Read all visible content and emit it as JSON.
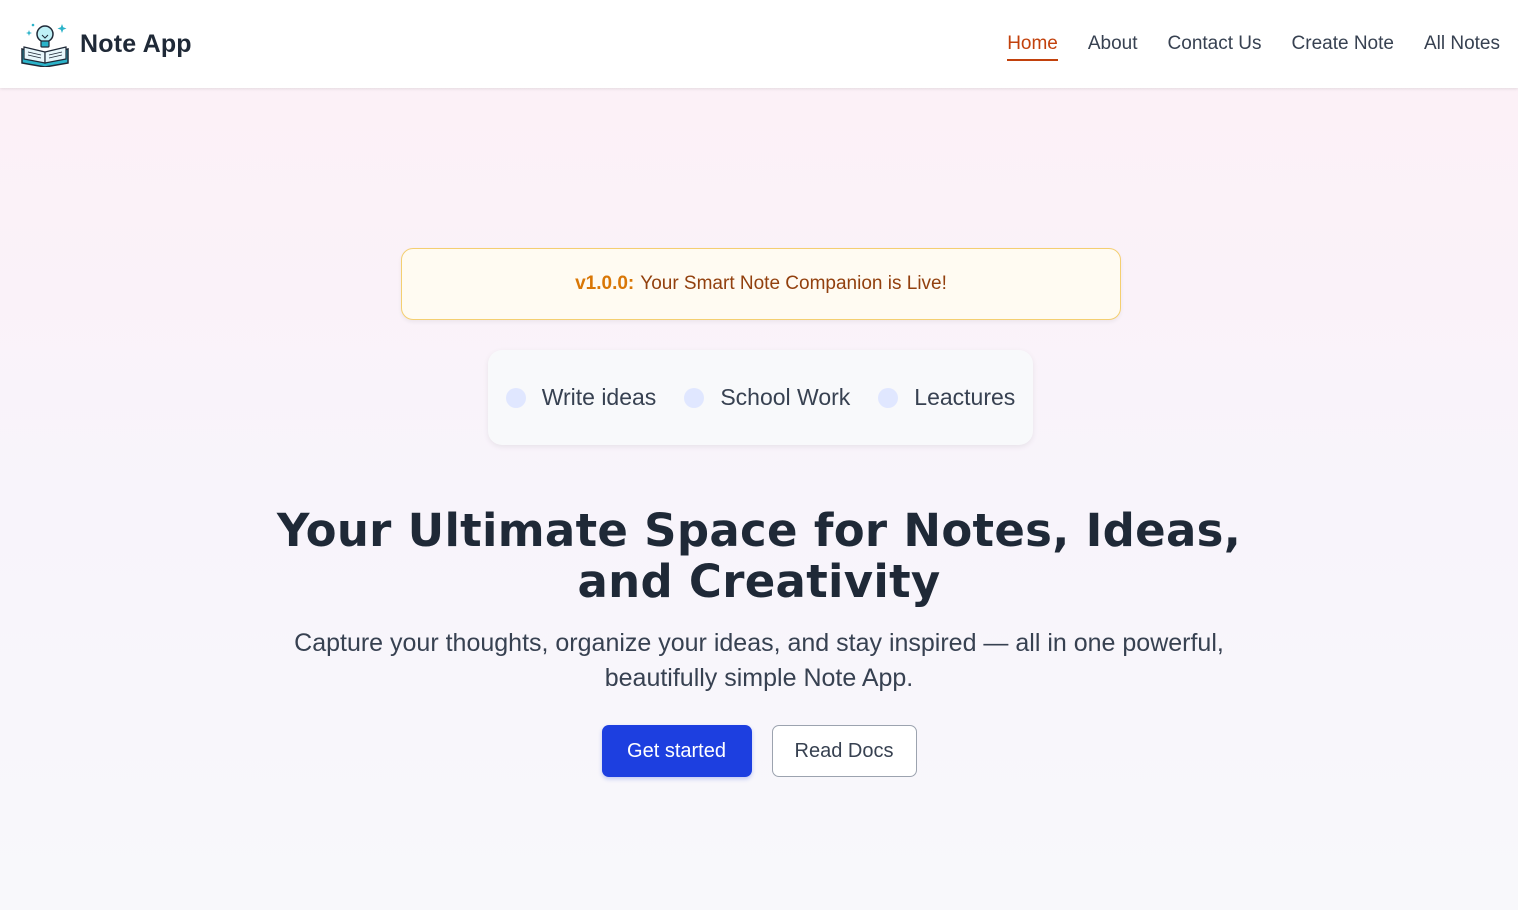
{
  "brand": {
    "name": "Note App",
    "logo_icon": "book-lightbulb-icon"
  },
  "nav": {
    "items": [
      {
        "label": "Home",
        "active": true
      },
      {
        "label": "About",
        "active": false
      },
      {
        "label": "Contact Us",
        "active": false
      },
      {
        "label": "Create Note",
        "active": false
      },
      {
        "label": "All Notes",
        "active": false
      }
    ]
  },
  "announcement": {
    "version": "v1.0.0:",
    "message": "Your Smart Note Companion is Live!"
  },
  "features": [
    {
      "label": "Write ideas"
    },
    {
      "label": "School Work"
    },
    {
      "label": "Leactures"
    }
  ],
  "hero": {
    "title": "Your Ultimate Space for Notes, Ideas, and Creativity",
    "subtitle": "Capture your thoughts, organize your ideas, and stay inspired — all in one powerful, beautifully simple Note App."
  },
  "cta": {
    "primary_label": "Get started",
    "secondary_label": "Read Docs"
  },
  "colors": {
    "accent": "#c2410c",
    "primary_button": "#1d3fe0",
    "announce_border": "#f4cf71",
    "text_dark": "#1f2937"
  }
}
